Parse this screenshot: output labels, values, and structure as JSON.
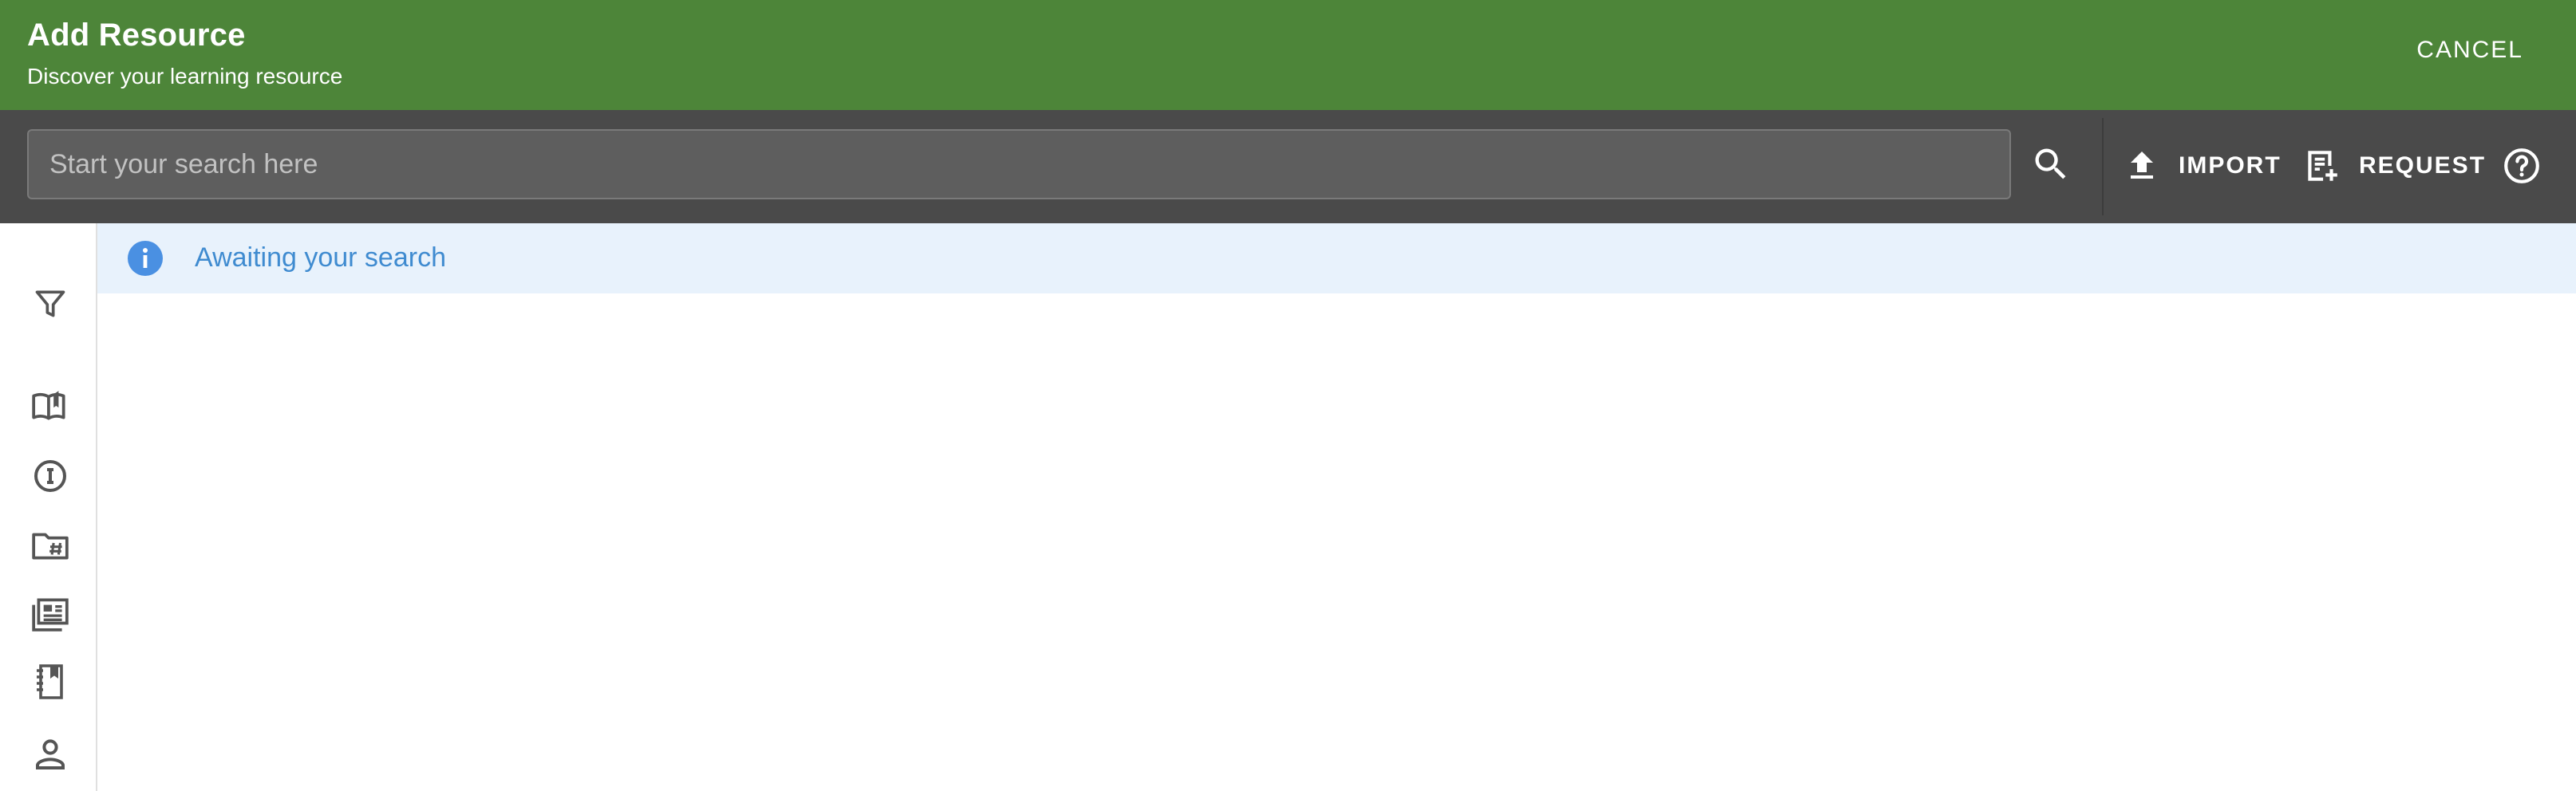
{
  "header": {
    "title": "Add Resource",
    "subtitle": "Discover your learning resource",
    "cancel_label": "CANCEL",
    "background_color": "#4d8539"
  },
  "toolbar": {
    "search_placeholder": "Start your search here",
    "search_value": "",
    "import_label": "IMPORT",
    "request_label": "REQUEST",
    "background_color": "#4a4a4a"
  },
  "sidebar": {
    "items": [
      {
        "icon": "filter-icon"
      },
      {
        "icon": "open-book-icon"
      },
      {
        "icon": "info-circle-icon"
      },
      {
        "icon": "hash-folder-icon"
      },
      {
        "icon": "news-icon"
      },
      {
        "icon": "notebook-icon"
      },
      {
        "icon": "person-icon"
      }
    ]
  },
  "content": {
    "status_message": "Awaiting your search",
    "status_icon": "info-icon",
    "accent_color": "#3f8bd0"
  }
}
